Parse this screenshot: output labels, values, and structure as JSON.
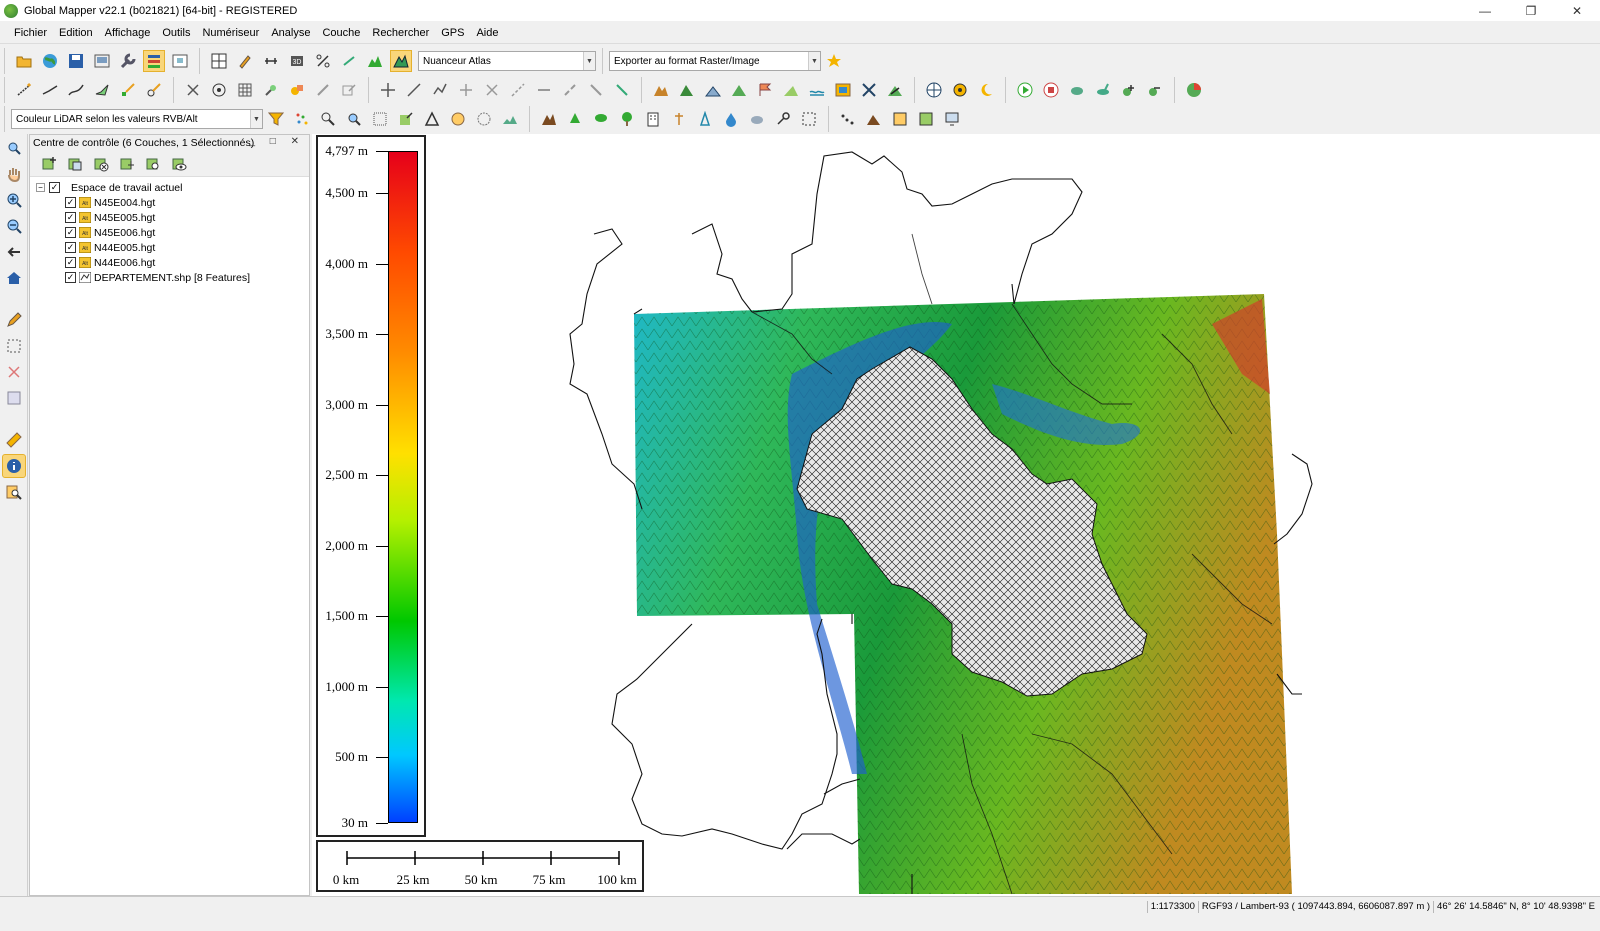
{
  "window": {
    "title": "Global Mapper v22.1 (b021821) [64-bit] - REGISTERED",
    "minimize": "—",
    "restore": "❐",
    "close": "✕"
  },
  "menu": [
    "Fichier",
    "Edition",
    "Affichage",
    "Outils",
    "Numériseur",
    "Analyse",
    "Couche",
    "Rechercher",
    "GPS",
    "Aide"
  ],
  "toolbar": {
    "shader_combo": "Nuanceur Atlas",
    "export_combo": "Exporter au format Raster/Image",
    "lidar_combo": "Couleur LiDAR selon les valeurs RVB/Alt"
  },
  "control_center": {
    "title": "Centre de contrôle (6 Couches, 1 Sélectionnés)",
    "controls": "_ □ ✕",
    "workspace": "Espace de travail actuel",
    "layers": [
      {
        "name": "N45E004.hgt",
        "checked": true,
        "kind": "raster"
      },
      {
        "name": "N45E005.hgt",
        "checked": true,
        "kind": "raster"
      },
      {
        "name": "N45E006.hgt",
        "checked": true,
        "kind": "raster"
      },
      {
        "name": "N44E005.hgt",
        "checked": true,
        "kind": "raster"
      },
      {
        "name": "N44E006.hgt",
        "checked": true,
        "kind": "raster"
      },
      {
        "name": "DEPARTEMENT.shp [8 Features]",
        "checked": true,
        "kind": "vector"
      }
    ]
  },
  "legend": {
    "max_label": "4,797 m",
    "labels": [
      "4,500 m",
      "4,000 m",
      "3,500 m",
      "3,000 m",
      "2,500 m",
      "2,000 m",
      "1,500 m",
      "1,000 m",
      "500 m"
    ],
    "min_label": "30 m",
    "colors": [
      "#e6001a",
      "#ff8c00",
      "#ffe000",
      "#00c800",
      "#00c8ff",
      "#0040ff"
    ]
  },
  "scale_bar": {
    "labels": [
      "0 km",
      "25 km",
      "50 km",
      "75 km",
      "100 km"
    ]
  },
  "status": {
    "scale": "1:1173300",
    "projection": "RGF93 / Lambert-93 ( 1097443.894, 6606087.897 m )",
    "geo": "46° 26' 14.5846\" N, 8° 10' 48.9398\" E"
  },
  "icons": {
    "main_toolbar": [
      "open-folder-icon",
      "globe-icon",
      "save-icon",
      "config-icon",
      "wrench-icon",
      "layers-icon",
      "overview-icon",
      "split-view-icon",
      "pick-icon",
      "measure-icon",
      "3d-view-icon",
      "percent-icon",
      "link-icon",
      "profile-icon",
      "shader-icon"
    ],
    "left_strip": [
      "zoom-box-icon",
      "pan-hand-icon",
      "zoom-in-icon",
      "zoom-out-icon",
      "back-icon",
      "home-icon",
      "edit-pencil-icon",
      "select-icon",
      "delete-icon",
      "attribute-icon",
      "ruler-icon",
      "info-icon",
      "search-icon"
    ]
  }
}
